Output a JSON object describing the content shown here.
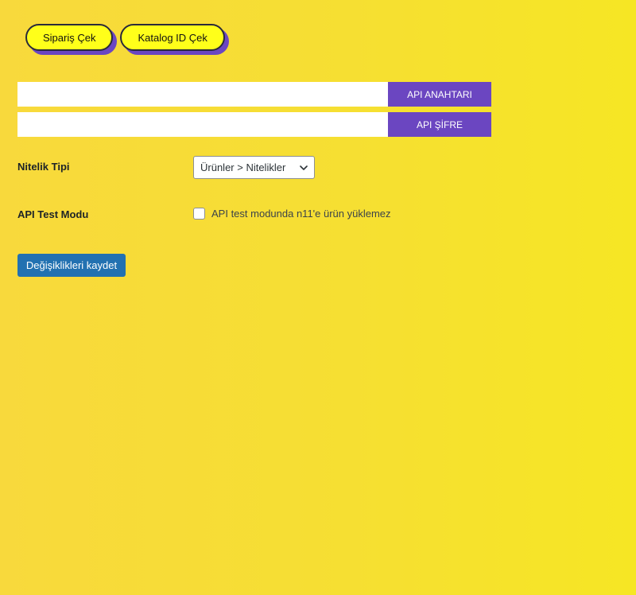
{
  "top_buttons": {
    "order_fetch_label": "Sipariş Çek",
    "catalog_fetch_label": "Katalog ID Çek"
  },
  "api_fields": {
    "key_value": "",
    "key_button_label": "API ANAHTARI",
    "secret_value": "",
    "secret_button_label": "API ŞİFRE"
  },
  "attribute_type": {
    "label": "Nitelik Tipi",
    "selected_value": "Ürünler > Nitelikler"
  },
  "test_mode": {
    "label": "API Test Modu",
    "checked": false,
    "checkbox_label": "API test modunda n11'e ürün yüklemez"
  },
  "save_button_label": "Değişiklikleri kaydet",
  "colors": {
    "accent_purple": "#6b46c1",
    "pill_yellow": "#ffff1a",
    "primary_blue": "#2271b1"
  }
}
